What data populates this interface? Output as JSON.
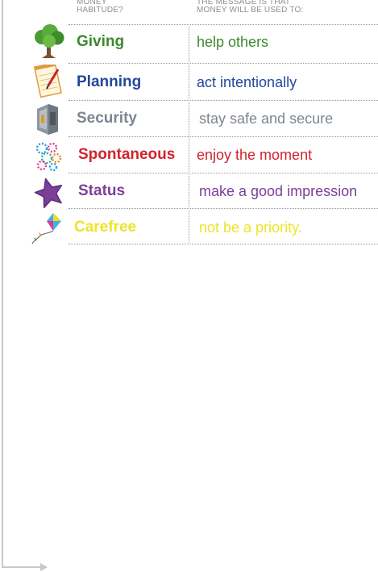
{
  "header": {
    "left_line1": "MONEY",
    "left_line2": "HABITUDE?",
    "right_line1": "THE MESSAGE IS THAT",
    "right_line2": "MONEY WILL BE USED TO:"
  },
  "rows": [
    {
      "label": "Giving",
      "message": "help others",
      "color": "#3c8a2e",
      "icon": "tree-icon"
    },
    {
      "label": "Planning",
      "message": "act intentionally",
      "color": "#23479b",
      "icon": "notepad-pen-icon"
    },
    {
      "label": "Security",
      "message": "stay safe and secure",
      "color": "#7d8690",
      "icon": "safe-icon"
    },
    {
      "label": "Spontaneous",
      "message": "enjoy the moment",
      "color": "#d2232a",
      "icon": "fireworks-icon"
    },
    {
      "label": "Status",
      "message": "make a good impression",
      "color": "#7b3f98",
      "icon": "star-icon"
    },
    {
      "label": "Carefree",
      "message": "not be a priority.",
      "color": "#ece42a",
      "icon": "kite-icon"
    }
  ]
}
